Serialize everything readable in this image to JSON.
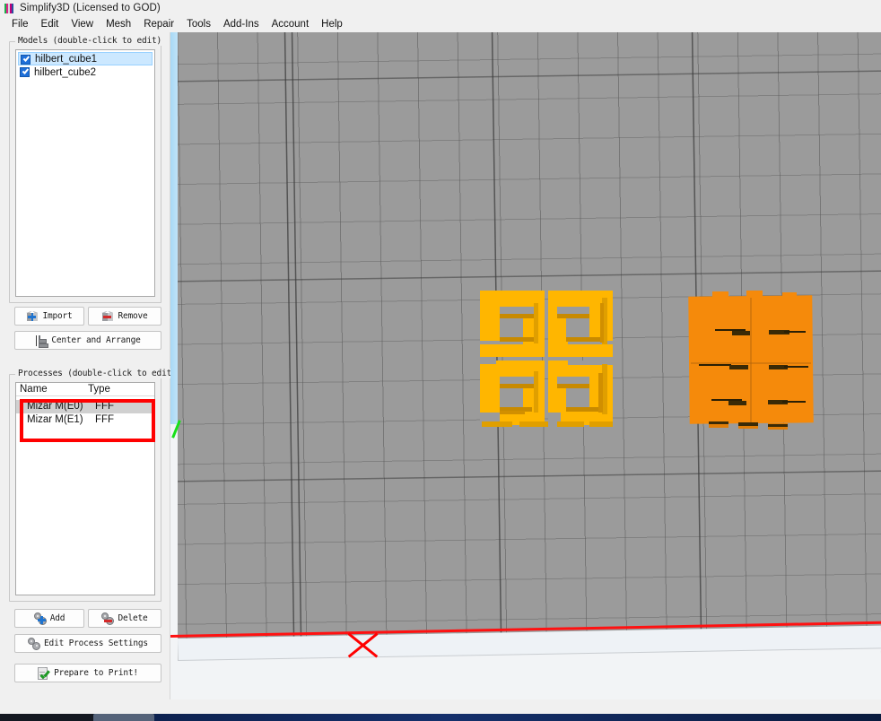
{
  "window": {
    "title": "Simplify3D (Licensed to GOD)",
    "icon": "simplify3d-logo-icon"
  },
  "menubar": {
    "items": [
      {
        "label": "File"
      },
      {
        "label": "Edit"
      },
      {
        "label": "View"
      },
      {
        "label": "Mesh"
      },
      {
        "label": "Repair"
      },
      {
        "label": "Tools"
      },
      {
        "label": "Add-Ins"
      },
      {
        "label": "Account"
      },
      {
        "label": "Help"
      }
    ]
  },
  "sidebar": {
    "models_group": {
      "title": "Models (double-click to edit)",
      "items": [
        {
          "name": "hilbert_cube1",
          "checked": true,
          "selected": true
        },
        {
          "name": "hilbert_cube2",
          "checked": true,
          "selected": false
        }
      ],
      "buttons": {
        "import": "Import",
        "remove": "Remove",
        "center_and_arrange": "Center and Arrange"
      }
    },
    "processes_group": {
      "title": "Processes (double-click to edit)",
      "columns": [
        "Name",
        "Type"
      ],
      "rows": [
        {
          "name": "Mizar M(E0)",
          "type": "FFF",
          "selected": true
        },
        {
          "name": "Mizar M(E1)",
          "type": "FFF",
          "selected": false
        }
      ],
      "buttons": {
        "add": "Add",
        "delete": "Delete",
        "edit_process_settings": "Edit Process Settings",
        "prepare_to_print": "Prepare to Print!"
      }
    }
  },
  "annotations": [
    {
      "name": "processes-list-highlight",
      "shape": "rectangle",
      "color": "#ff0000",
      "target": "process list rows"
    }
  ],
  "viewport": {
    "build_plate_color": "#9b9b9b",
    "grid_line_color": "#5a5a5a",
    "front_edge_color": "#ff1111",
    "y_axis_color": "#19e019",
    "origin_marker": "red-x-marker",
    "models": [
      {
        "name": "hilbert_cube1",
        "color": "#ffb600",
        "shape": "hilbert-curve-cube",
        "position": "center-left"
      },
      {
        "name": "hilbert_cube2",
        "color": "#f58a0b",
        "shape": "solid-slab-with-slits",
        "position": "center-right"
      }
    ]
  },
  "taskbar": {
    "accent_color": "#15306c"
  }
}
